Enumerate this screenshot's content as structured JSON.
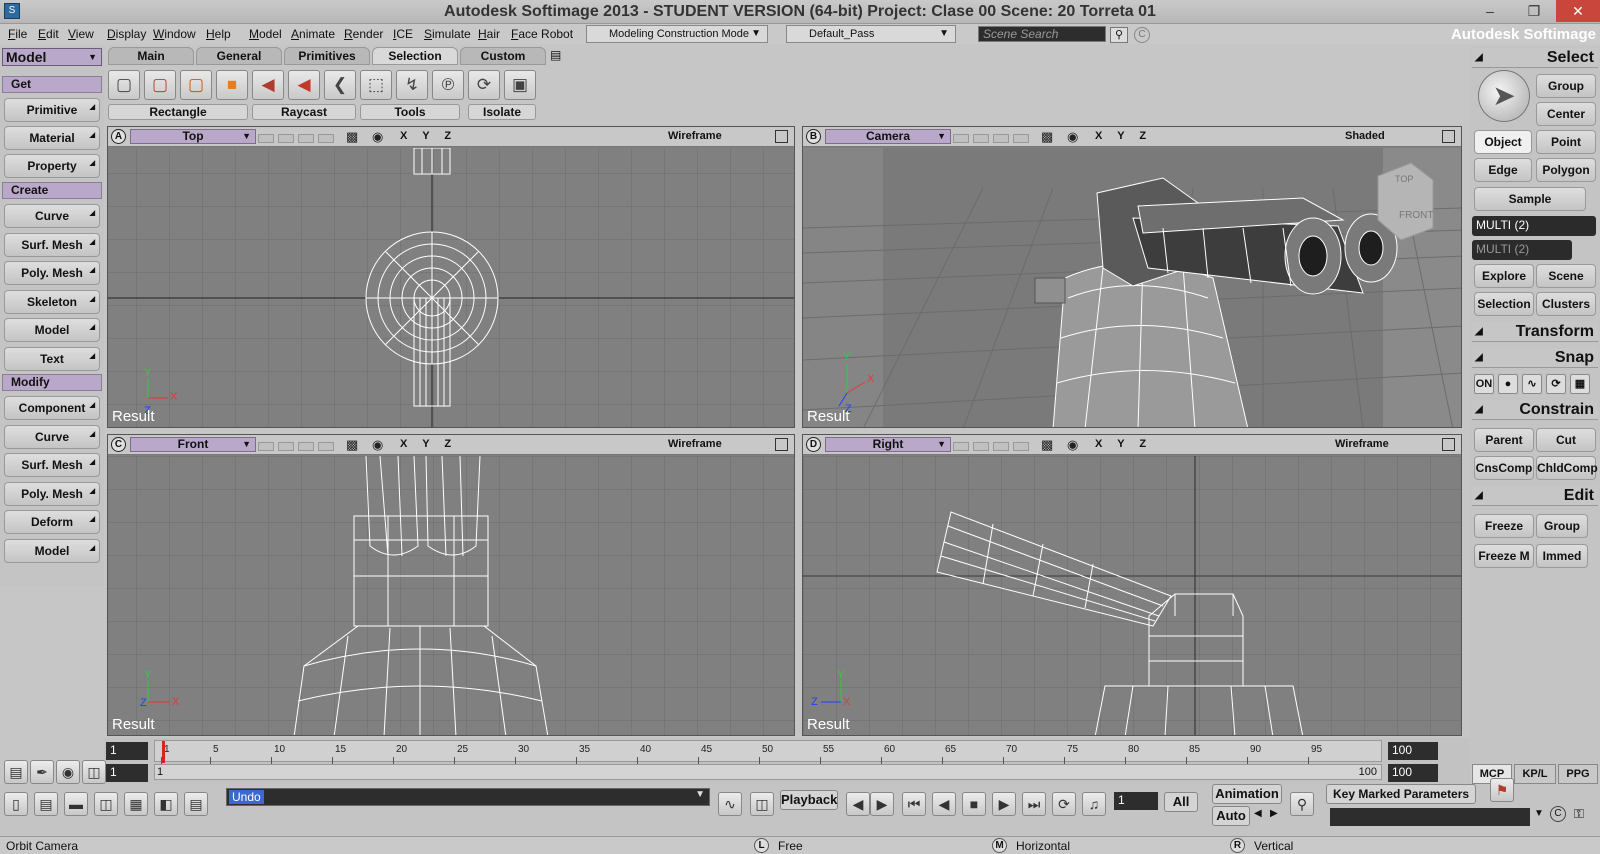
{
  "title_bar": {
    "title": "Autodesk Softimage 2013  - STUDENT VERSION (64-bit)     Project: Clase 00      Scene: 20 Torreta 01"
  },
  "menu": [
    "File",
    "Edit",
    "View",
    "Display",
    "Window",
    "Help",
    "Model",
    "Animate",
    "Render",
    "ICE",
    "Simulate",
    "Hair",
    "Face Robot"
  ],
  "construction_mode": "Modeling Construction Mode",
  "render_pass": "Default_Pass",
  "scene_search_placeholder": "Scene Search",
  "brand": "Autodesk Softimage",
  "left_panel": {
    "mode": "Model",
    "get_header": "Get",
    "get_items": [
      "Primitive",
      "Material",
      "Property"
    ],
    "create_header": "Create",
    "create_items": [
      "Curve",
      "Surf. Mesh",
      "Poly. Mesh",
      "Skeleton",
      "Model",
      "Text"
    ],
    "modify_header": "Modify",
    "modify_items": [
      "Component",
      "Curve",
      "Surf. Mesh",
      "Poly. Mesh",
      "Deform",
      "Model"
    ]
  },
  "toolbar": {
    "tabs": [
      "Main",
      "General",
      "Primitives",
      "Selection",
      "Custom"
    ],
    "active_tab": "Selection",
    "labels": [
      "Rectangle",
      "Raycast",
      "Tools",
      "Isolate"
    ]
  },
  "viewports": {
    "a": {
      "letter": "A",
      "camera": "Top",
      "mode": "Wireframe",
      "result": "Result"
    },
    "b": {
      "letter": "B",
      "camera": "Camera",
      "mode": "Shaded",
      "result": "Result"
    },
    "c": {
      "letter": "C",
      "camera": "Front",
      "mode": "Wireframe",
      "result": "Result"
    },
    "d": {
      "letter": "D",
      "camera": "Right",
      "mode": "Wireframe",
      "result": "Result"
    },
    "axes": "X Y Z",
    "cube_top": "TOP",
    "cube_front": "FRONT"
  },
  "right_panel": {
    "select_header": "Select",
    "group": "Group",
    "center": "Center",
    "object": "Object",
    "point": "Point",
    "edge": "Edge",
    "polygon": "Polygon",
    "sample": "Sample",
    "multi1": "MULTI (2)",
    "multi2": "MULTI (2)",
    "explore": "Explore",
    "scene": "Scene",
    "selection": "Selection",
    "clusters": "Clusters",
    "transform_header": "Transform",
    "snap_header": "Snap",
    "snap_on": "ON",
    "constrain_header": "Constrain",
    "parent": "Parent",
    "cut": "Cut",
    "cnscomp": "CnsComp",
    "chldcomp": "ChldComp",
    "edit_header": "Edit",
    "freeze": "Freeze",
    "edit_group": "Group",
    "freeze_m": "Freeze M",
    "immed": "Immed",
    "tabs": [
      "MCP",
      "KP/L",
      "PPG"
    ]
  },
  "timeline": {
    "start": "1",
    "end": "100",
    "range_start": "1",
    "range_end": "100",
    "range_inner_start": "1",
    "range_inner_end": "100",
    "ticks": [
      "1",
      "5",
      "10",
      "15",
      "20",
      "25",
      "30",
      "35",
      "40",
      "45",
      "50",
      "55",
      "60",
      "65",
      "70",
      "75",
      "80",
      "85",
      "90",
      "95"
    ]
  },
  "bottom": {
    "undo": "Undo",
    "playback": "Playback",
    "frame": "1",
    "all": "All",
    "animation": "Animation",
    "auto": "Auto",
    "key_marked": "Key Marked Parameters"
  },
  "status": {
    "message": "Orbit Camera",
    "l_key": "L",
    "l_text": "Free",
    "m_key": "M",
    "m_text": "Horizontal",
    "r_key": "R",
    "r_text": "Vertical"
  },
  "colors": {
    "viewport_bg": "#808080",
    "section_header": "#b9a8c9",
    "grid": "#6a6a6a",
    "playhead": "#e02020"
  }
}
